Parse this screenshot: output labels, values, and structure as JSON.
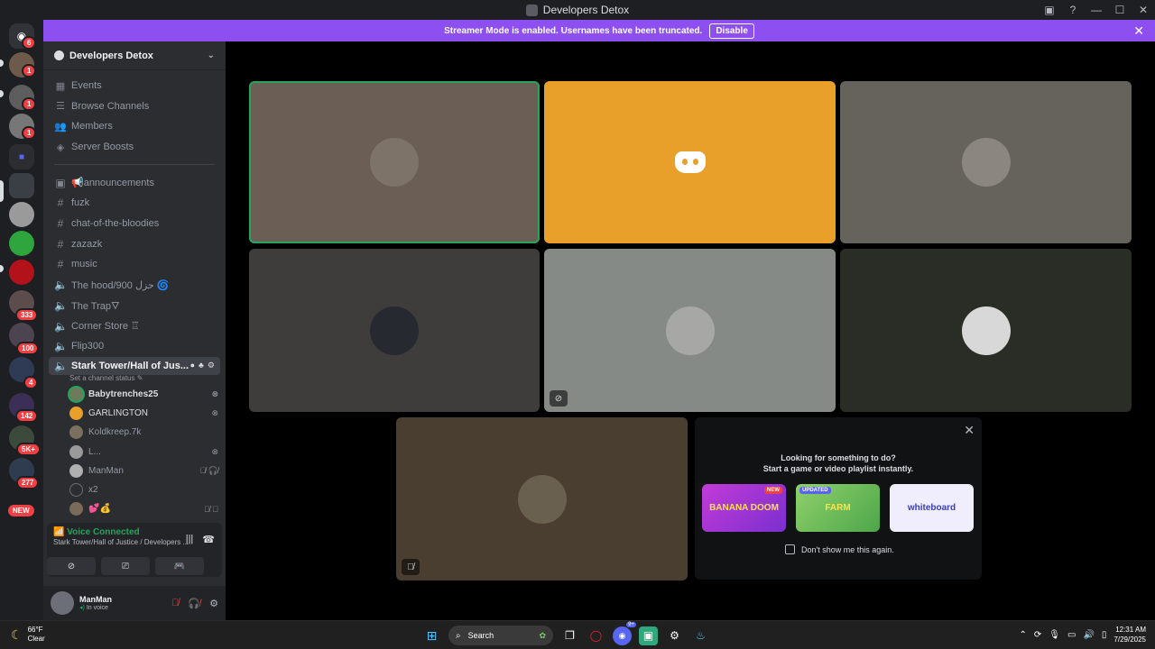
{
  "window": {
    "title": "Developers Detox"
  },
  "banner": {
    "text": "Streamer Mode is enabled. Usernames have been truncated.",
    "disable_label": "Disable"
  },
  "guild_badges": [
    "6",
    "1",
    "1",
    "1",
    "333",
    "100",
    "4",
    "142",
    "5K+",
    "277"
  ],
  "guild_new": "NEW",
  "server": {
    "name": "Developers Detox"
  },
  "menu": [
    {
      "label": "Events",
      "icon": "calendar-icon"
    },
    {
      "label": "Browse Channels",
      "icon": "browse-icon"
    },
    {
      "label": "Members",
      "icon": "members-icon"
    },
    {
      "label": "Server Boosts",
      "icon": "boost-icon"
    }
  ],
  "channels": [
    {
      "label": "📢announcements",
      "type": "announce"
    },
    {
      "label": "fuzk",
      "type": "text"
    },
    {
      "label": "chat-of-the-bloodies",
      "type": "text"
    },
    {
      "label": "zazazk",
      "type": "text"
    },
    {
      "label": "music",
      "type": "text"
    },
    {
      "label": "The hood/900 ﺣﺰﻝ 🌀",
      "type": "voice"
    },
    {
      "label": "The Trap🜄",
      "type": "voice"
    },
    {
      "label": "Corner Store ♖",
      "type": "voice"
    },
    {
      "label": "Flip300",
      "type": "voice"
    }
  ],
  "active_channel": {
    "label": "Stark Tower/Hall of Jus...",
    "status": "Set a channel status"
  },
  "voice_users": [
    {
      "name": "Babytrenches25",
      "state": "⊗",
      "bold": true,
      "speaking": true
    },
    {
      "name": "GARLINGTON",
      "state": "⊗",
      "bold": false,
      "speaking": false
    },
    {
      "name": "Koldkreep.7k",
      "state": "",
      "bold": false,
      "speaking": false
    },
    {
      "name": "L...",
      "state": "⊗",
      "bold": false,
      "speaking": false
    },
    {
      "name": "ManMan",
      "state": "🎙̸ 🎧̸",
      "bold": false,
      "speaking": false
    },
    {
      "name": "x2",
      "state": "",
      "bold": false,
      "speaking": false
    },
    {
      "name": "💕💰",
      "state": "🎙̸ ⏵",
      "bold": false,
      "speaking": false
    }
  ],
  "voice": {
    "status": "Voice Connected",
    "location": "Stark Tower/Hall of Justice / Developers ..."
  },
  "user": {
    "name": "ManMan",
    "status": "In voice"
  },
  "activity": {
    "line1": "Looking for something to do?",
    "line2": "Start a game or video playlist instantly.",
    "cards": [
      {
        "name": "BANANA DOOM",
        "tag": "NEW"
      },
      {
        "name": "FARM",
        "tag": "UPDATED"
      },
      {
        "name": "whiteboard",
        "tag": ""
      }
    ],
    "dont_show": "Don't show me this again."
  },
  "taskbar": {
    "temp": "66°F",
    "weather": "Clear",
    "search": "Search",
    "discord_badge": "9+",
    "time": "12:31 AM",
    "date": "7/29/2025"
  }
}
